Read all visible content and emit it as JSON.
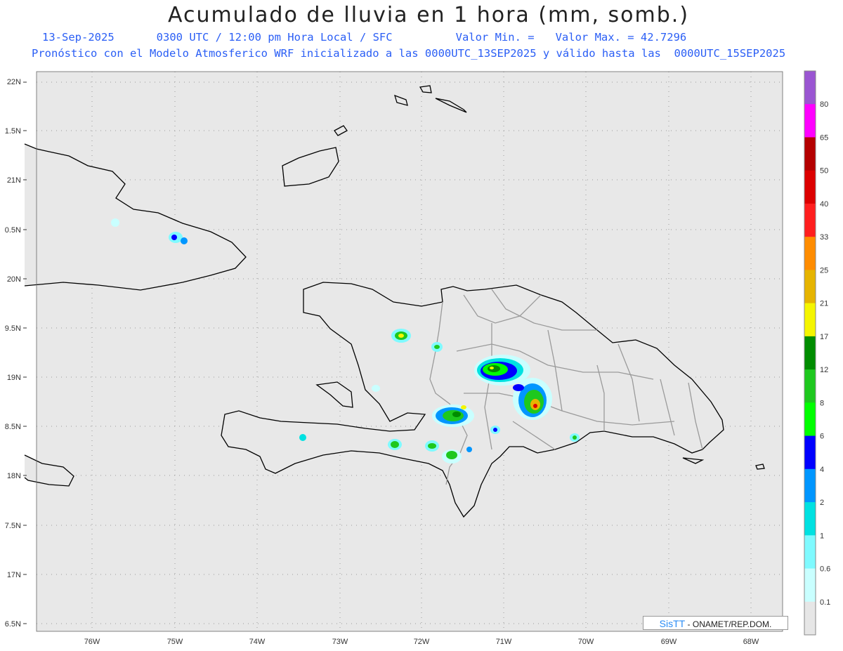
{
  "title": "Acumulado de lluvia en 1 hora (mm, somb.)",
  "subtitle": {
    "date": "13-Sep-2025",
    "time": "0300 UTC / 12:00 pm Hora Local / SFC",
    "min_label": "Valor Min. =",
    "max_label": "Valor Max. = 42.7296",
    "model_info": "Pronóstico con el Modelo Atmosferico WRF inicializado a las 0000UTC_13SEP2025 y válido hasta las  0000UTC_15SEP2025"
  },
  "axes": {
    "lat_ticks": [
      "22N",
      "1.5N",
      "21N",
      "0.5N",
      "20N",
      "9.5N",
      "19N",
      "8.5N",
      "18N",
      "7.5N",
      "17N",
      "6.5N"
    ],
    "lon_ticks": [
      "76W",
      "75W",
      "74W",
      "73W",
      "72W",
      "71W",
      "70W",
      "69W",
      "68W"
    ]
  },
  "colorbar": {
    "labels": [
      "80",
      "65",
      "50",
      "40",
      "33",
      "25",
      "21",
      "17",
      "12",
      "8",
      "6",
      "4",
      "2",
      "1",
      "0.6",
      "0.1"
    ],
    "colors": [
      "#9a55d2",
      "#ff00ff",
      "#b40000",
      "#dc0000",
      "#ff1e1e",
      "#ff8c00",
      "#e6b400",
      "#f5f500",
      "#008c00",
      "#1ec81e",
      "#00ff00",
      "#0000ff",
      "#0096ff",
      "#00e1e1",
      "#7ffaff",
      "#c9ffff",
      "#e6e6e6"
    ]
  },
  "credit": {
    "brand": "SisTT",
    "text": "- ONAMET/REP.DOM."
  },
  "colors": {
    "map_bg": "#e8e8e8",
    "coast": "#000000",
    "borders": "#9a9a9a",
    "accent_text": "#2a5ef5"
  }
}
